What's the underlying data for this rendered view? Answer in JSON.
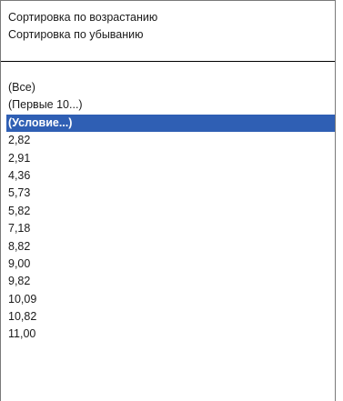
{
  "menu": {
    "sort_ascending_label": "Сортировка по возрастанию",
    "sort_descending_label": "Сортировка по убыванию"
  },
  "filter": {
    "selected_index": 2,
    "items": [
      "(Все)",
      "(Первые 10...)",
      "(Условие...)",
      "2,82",
      "2,91",
      "4,36",
      "5,73",
      "5,82",
      "7,18",
      "8,82",
      "9,00",
      "9,82",
      "10,09",
      "10,82",
      "11,00"
    ]
  },
  "colors": {
    "selection_background": "#2f5fb4",
    "selection_text": "#ffffff"
  }
}
